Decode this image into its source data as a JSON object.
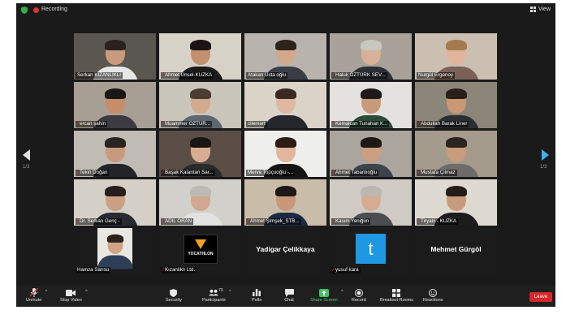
{
  "topbar": {
    "recording": "Recording",
    "view": "View"
  },
  "pages": {
    "left": "1/3",
    "right": "1/3"
  },
  "participants": [
    {
      "name": "Serkan KIZANLIKLI",
      "muted": false,
      "bg": "#5a5750",
      "skin": "#c99a7e",
      "hair": "#2b2220",
      "shirt": "#e6e6e6"
    },
    {
      "name": "Ahmet Ünsel-KUZKA",
      "muted": true,
      "bg": "#d7d2c8",
      "skin": "#c3906f",
      "hair": "#1b1412",
      "shirt": "#1a1a1a"
    },
    {
      "name": "Atakan Usta oğlu",
      "muted": false,
      "bg": "#b8b4ad",
      "skin": "#d2a88c",
      "hair": "#2f241c",
      "shirt": "#3a3e44"
    },
    {
      "name": "Haluk ÖZTÜRK SEV...",
      "muted": true,
      "bg": "#a8a29a",
      "skin": "#d8b199",
      "hair": "#c9c5bf",
      "shirt": "#2d2f35"
    },
    {
      "name": "Nurgül Ergenoy",
      "muted": false,
      "bg": "#cbbfb2",
      "skin": "#e0b59c",
      "hair": "#a67a4e",
      "shirt": "#7a6256"
    },
    {
      "name": "ercan şahin",
      "muted": true,
      "bg": "#a79f93",
      "skin": "#c58d6a",
      "hair": "#1b1714",
      "shirt": "#3c3b41"
    },
    {
      "name": "Muammer ÖZTÜR...",
      "muted": true,
      "bg": "#c9c5bb",
      "skin": "#d2aa8e",
      "hair": "#4b3d32",
      "shirt": "#5e6670"
    },
    {
      "name": "cilemert",
      "muted": false,
      "bg": "#d9d3c8",
      "skin": "#e0b7a1",
      "hair": "#3b2a1f",
      "shirt": "#25272c"
    },
    {
      "name": "Kemalcan Tunahan K...",
      "muted": true,
      "bg": "#e4e2de",
      "skin": "#c89a7c",
      "hair": "#1f1a17",
      "shirt": "#2b4a3a"
    },
    {
      "name": "Abdullah Barak Liner",
      "muted": true,
      "bg": "#8c8679",
      "skin": "#c99876",
      "hair": "#2a1f18",
      "shirt": "#2c2e33"
    },
    {
      "name": "Tekin Doğan",
      "muted": true,
      "bg": "#c0bbb3",
      "skin": "#c79a7e",
      "hair": "#2a2420",
      "shirt": "#222428"
    },
    {
      "name": "Başak Kalantari Sar...",
      "muted": true,
      "bg": "#5b4e47",
      "skin": "#d9ad93",
      "hair": "#1c1613",
      "shirt": "#2a2a2a"
    },
    {
      "name": "Merve Topçuoğlu -...",
      "muted": false,
      "bg": "#eeeeea",
      "skin": "#e2b69d",
      "hair": "#2a1d16",
      "shirt": "#141414",
      "active": true
    },
    {
      "name": "Ahmet Tabanlıoğlu",
      "muted": true,
      "bg": "#aaa59d",
      "skin": "#cc9e82",
      "hair": "#1e1915",
      "shirt": "#3d434b"
    },
    {
      "name": "Mustafa Çilmaz",
      "muted": true,
      "bg": "#a49b8c",
      "skin": "#c89b7d",
      "hair": "#2c241e",
      "shirt": "#6d6c6a"
    },
    {
      "name": "Dr. Serkan Genç -",
      "muted": true,
      "bg": "#d5d0c7",
      "skin": "#caa084",
      "hair": "#261f1b",
      "shirt": "#272a30"
    },
    {
      "name": "ADİL ORAN",
      "muted": true,
      "bg": "#d2d0cb",
      "skin": "#d1a88e",
      "hair": "#bdbab5",
      "shirt": "#e2e2e2"
    },
    {
      "name": "Ahmet Şimşek_STB...",
      "muted": true,
      "bg": "#c9bda9",
      "skin": "#c9987a",
      "hair": "#1f1915",
      "shirt": "#1d2a45"
    },
    {
      "name": "Kasım Yeniğün",
      "muted": true,
      "bg": "#cfcbc4",
      "skin": "#d5ab91",
      "hair": "#bcb7b0",
      "shirt": "#4a4d52"
    },
    {
      "name": "Tiryaki - KUZKA",
      "muted": true,
      "bg": "#dedad2",
      "skin": "#c99b7d",
      "hair": "#231c18",
      "shirt": "#1c1c1c"
    },
    {
      "name": "Hamza Sarısu",
      "muted": false,
      "type": "photo",
      "bg": "#1b1b1b",
      "skin": "#cfa386",
      "hair": "#2a211b",
      "shirt": "#2d3e58"
    },
    {
      "name": "Kızanlıklı Ltd.",
      "muted": true,
      "type": "logo",
      "bg": "#1b1b1b",
      "logo": "YOCATHLON"
    },
    {
      "name": "",
      "muted": false,
      "type": "text",
      "bg": "#1b1b1b",
      "big": "Yadigar Çelikkaya"
    },
    {
      "name": "yusuf kara",
      "muted": true,
      "type": "initial",
      "bg": "#1b1b1b",
      "initial": "t"
    },
    {
      "name": "",
      "muted": false,
      "type": "text",
      "bg": "#1b1b1b",
      "big": "Mehmet Gürgöl"
    }
  ],
  "toolbar": {
    "unmute": "Unmute",
    "stop_video": "Stop Video",
    "security": "Security",
    "participants": "Participants",
    "participants_count": "73",
    "polls": "Polls",
    "chat": "Chat",
    "share_screen": "Share Screen",
    "record": "Record",
    "breakout_rooms": "Breakout Rooms",
    "reactions": "Reactions",
    "leave": "Leave"
  }
}
